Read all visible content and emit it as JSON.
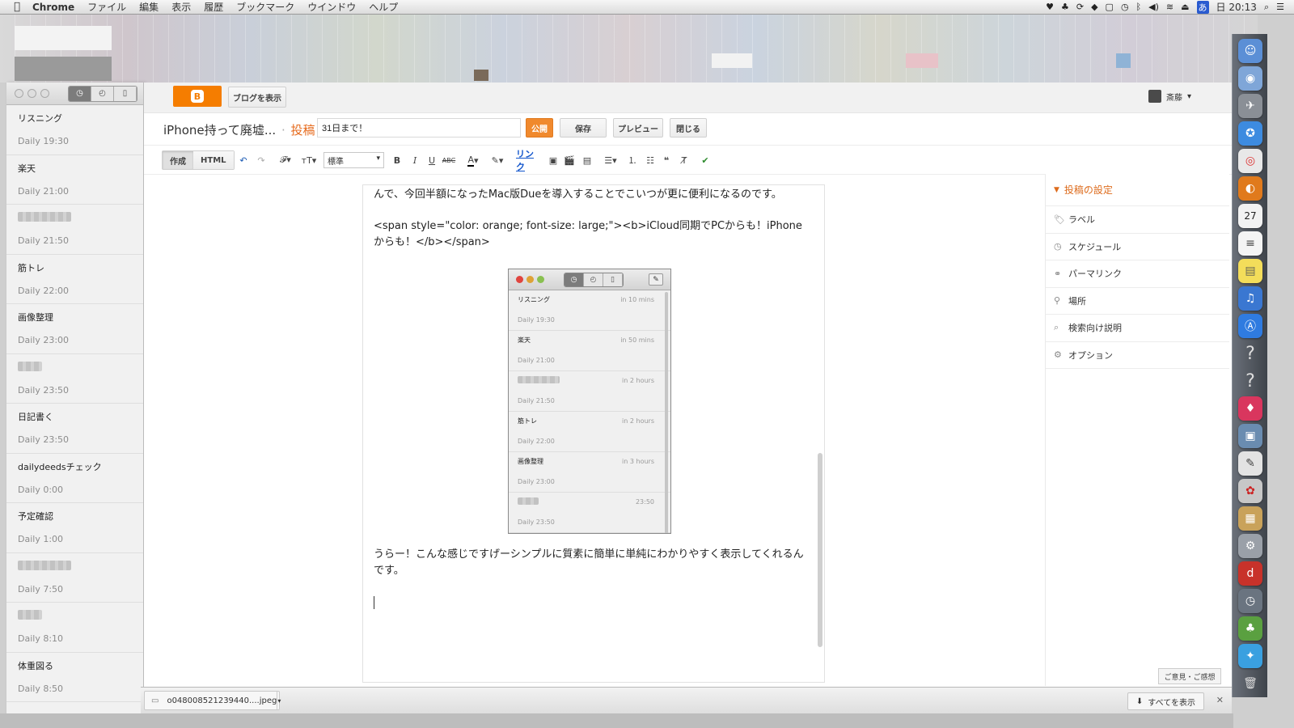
{
  "menubar": {
    "app": "Chrome",
    "menus": [
      "ファイル",
      "編集",
      "表示",
      "履歴",
      "ブックマーク",
      "ウインドウ",
      "ヘルプ"
    ],
    "clock": "日 20:13",
    "input_indicator": "あ"
  },
  "due": {
    "items": [
      {
        "name": "リスニング",
        "time": "Daily 19:30"
      },
      {
        "name": "楽天",
        "time": "Daily 21:00"
      },
      {
        "name": "",
        "time": "Daily 21:50",
        "blurred": true
      },
      {
        "name": "筋トレ",
        "time": "Daily 22:00"
      },
      {
        "name": "画像整理",
        "time": "Daily 23:00"
      },
      {
        "name": "",
        "time": "Daily 23:50",
        "blurred": true
      },
      {
        "name": "日記書く",
        "time": "Daily 23:50"
      },
      {
        "name": "dailydeedsチェック",
        "time": "Daily 0:00"
      },
      {
        "name": "予定確認",
        "time": "Daily 1:00"
      },
      {
        "name": "",
        "time": "Daily 7:50",
        "blurred": true
      },
      {
        "name": "",
        "time": "Daily 8:10",
        "blurred": true
      },
      {
        "name": "体重図る",
        "time": "Daily 8:50"
      }
    ]
  },
  "blogger": {
    "view_blog_label": "ブログを表示",
    "user_name": "斎藤",
    "blog_name": "iPhone持って廃墟...",
    "separator": "·",
    "section": "投稿",
    "title_value": "31日まで！",
    "publish_label": "公開",
    "save_label": "保存",
    "preview_label": "プレビュー",
    "close_label": "閉じる",
    "mode_compose": "作成",
    "mode_html": "HTML",
    "format_value": "標準",
    "link_label": "リンク"
  },
  "editor": {
    "para1": "んで、今回半額になったMac版Dueを導入することでこいつが更に便利になるのです。",
    "para2": "<span style=\"color: orange; font-size: large;\"><b>iCloud同期でPCからも！iPhoneからも！</b></span>",
    "para3": "うらー！こんな感じですげーシンプルに質素に簡単に単純にわかりやすく表示してくれるんです。"
  },
  "screenshot": {
    "items": [
      {
        "name": "リスニング",
        "due": "in 10 mins",
        "time": "Daily 19:30"
      },
      {
        "name": "楽天",
        "due": "in 50 mins",
        "time": "Daily 21:00"
      },
      {
        "name": "",
        "due": "in 2 hours",
        "time": "Daily 21:50",
        "blurred": true
      },
      {
        "name": "筋トレ",
        "due": "in 2 hours",
        "time": "Daily 22:00"
      },
      {
        "name": "画像整理",
        "due": "in 3 hours",
        "time": "Daily 23:00"
      },
      {
        "name": "",
        "due": "23:50",
        "time": "Daily 23:50",
        "blurred": true
      }
    ]
  },
  "settings": {
    "header": "投稿の設定",
    "rows": [
      {
        "icon": "tag-icon",
        "label": "ラベル"
      },
      {
        "icon": "clock-icon",
        "label": "スケジュール"
      },
      {
        "icon": "link-icon",
        "label": "パーマリンク"
      },
      {
        "icon": "location-pin-icon",
        "label": "場所"
      },
      {
        "icon": "search-icon",
        "label": "検索向け説明"
      },
      {
        "icon": "gear-icon",
        "label": "オプション"
      }
    ]
  },
  "feedback_label": "ご意見・ご感想",
  "downloads": {
    "file_name": "o048008521239440....jpeg",
    "show_all_label": "すべてを表示"
  },
  "colors": {
    "blogger_orange": "#f57d00",
    "publish_orange": "#f0892d",
    "settings_orange": "#dd6b1c",
    "link_blue": "#1155cc"
  }
}
